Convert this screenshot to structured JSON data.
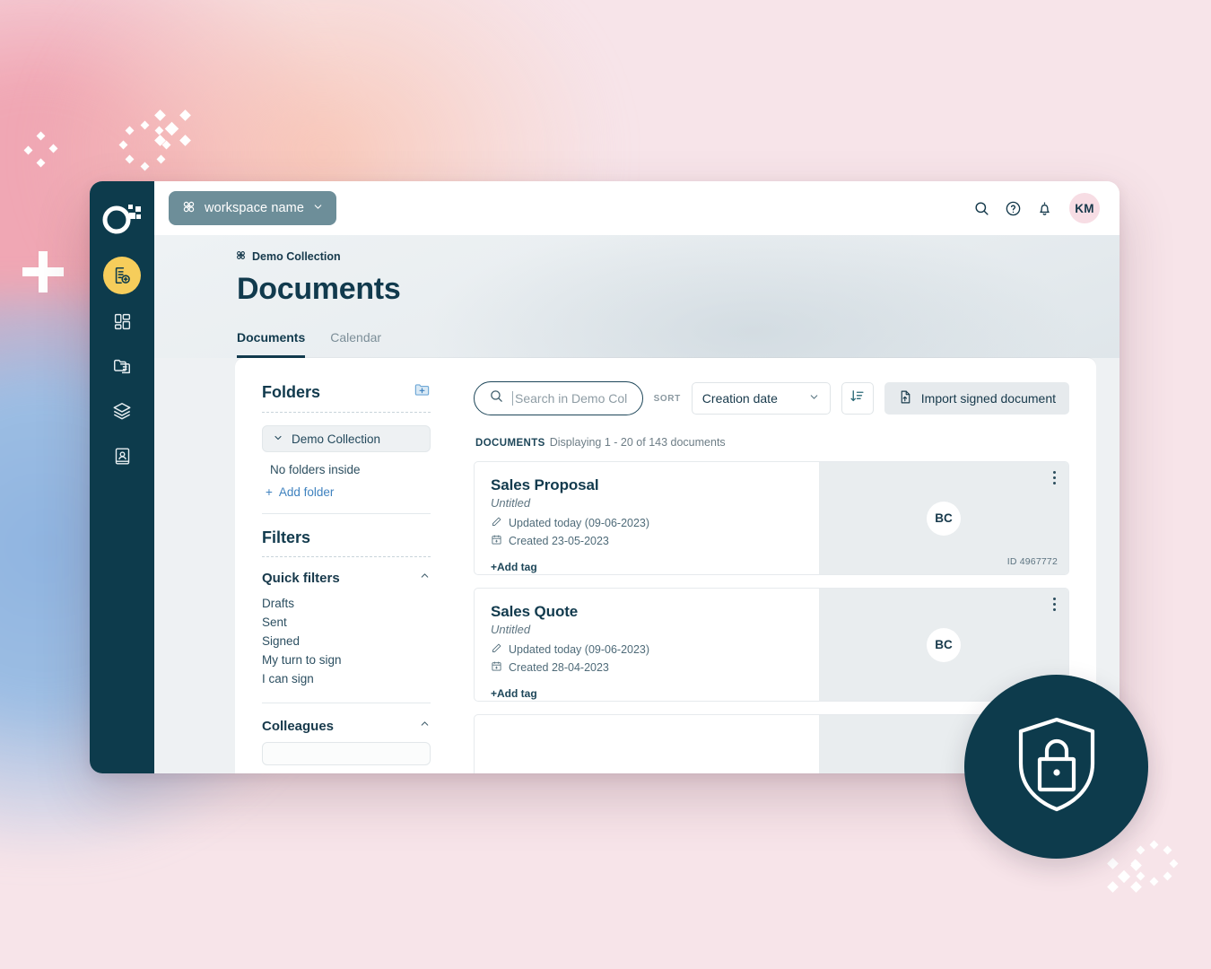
{
  "brand": {
    "rail_bg": "#0d3b4c",
    "accent_yellow": "#f6cd5b",
    "title_color": "#113a4d",
    "link_blue": "#3f82bf"
  },
  "rail": {
    "logo_name": "oneflow-logo",
    "items": [
      {
        "name": "new-document",
        "icon": "document-add-icon",
        "active": true
      },
      {
        "name": "dashboard",
        "icon": "dashboard-grid-icon",
        "active": false
      },
      {
        "name": "templates",
        "icon": "templates-icon",
        "active": false
      },
      {
        "name": "collections",
        "icon": "layers-icon",
        "active": false
      },
      {
        "name": "contacts",
        "icon": "contact-book-icon",
        "active": false
      }
    ]
  },
  "topbar": {
    "workspace_label": "workspace name",
    "workspace_icon": "workspace-atom-icon",
    "chevron_icon": "chevron-down-icon",
    "actions": [
      {
        "name": "search",
        "icon": "search-icon"
      },
      {
        "name": "help",
        "icon": "help-circle-icon"
      },
      {
        "name": "notifications",
        "icon": "bell-icon"
      }
    ],
    "avatar_initials": "KM"
  },
  "page": {
    "breadcrumb": "Demo Collection",
    "breadcrumb_icon": "collection-atom-icon",
    "title": "Documents",
    "tabs": [
      {
        "label": "Documents",
        "active": true
      },
      {
        "label": "Calendar",
        "active": false
      }
    ]
  },
  "folders": {
    "title": "Folders",
    "add_folder_icon": "folder-add-icon",
    "collection_label": "Demo Collection",
    "collection_chevron": "chevron-down-icon",
    "empty_text": "No folders inside",
    "add_folder_label": "Add folder",
    "add_folder_plus": "+"
  },
  "filters": {
    "title": "Filters",
    "groups": [
      {
        "title": "Quick filters",
        "collapse_icon": "chevron-up-icon",
        "items": [
          "Drafts",
          "Sent",
          "Signed",
          "My turn to sign",
          "I can sign"
        ]
      },
      {
        "title": "Colleagues",
        "collapse_icon": "chevron-up-icon",
        "items": []
      }
    ]
  },
  "toolbar": {
    "search_placeholder": "Search in Demo Collection",
    "search_value": "",
    "search_icon": "search-icon",
    "sort_label": "SORT",
    "sort_value": "Creation date",
    "sort_options": [
      "Creation date"
    ],
    "sort_chevron": "chevron-down-icon",
    "sort_direction_icon": "sort-descending-icon",
    "import_label": "Import signed document",
    "import_icon": "import-document-icon"
  },
  "list": {
    "label": "DOCUMENTS",
    "meta": "Displaying 1 - 20 of 143 documents",
    "documents": [
      {
        "title": "Sales Proposal",
        "subtitle": "Untitled",
        "updated": "Updated today (09-06-2023)",
        "updated_icon": "pencil-icon",
        "created": "Created 23-05-2023",
        "created_icon": "calendar-icon",
        "add_tag": "+Add tag",
        "avatar_initials": "BC",
        "id_label": "ID 4967772",
        "kebab_icon": "more-vertical-icon"
      },
      {
        "title": "Sales Quote",
        "subtitle": "Untitled",
        "updated": "Updated today (09-06-2023)",
        "updated_icon": "pencil-icon",
        "created": "Created 28-04-2023",
        "created_icon": "calendar-icon",
        "add_tag": "+Add tag",
        "avatar_initials": "BC",
        "id_label": "",
        "kebab_icon": "more-vertical-icon"
      },
      {
        "title": "",
        "subtitle": "",
        "updated": "",
        "updated_icon": "pencil-icon",
        "created": "",
        "created_icon": "calendar-icon",
        "add_tag": "",
        "avatar_initials": "",
        "id_label": "",
        "kebab_icon": "more-vertical-icon"
      }
    ]
  },
  "badge": {
    "icon": "shield-lock-icon"
  }
}
